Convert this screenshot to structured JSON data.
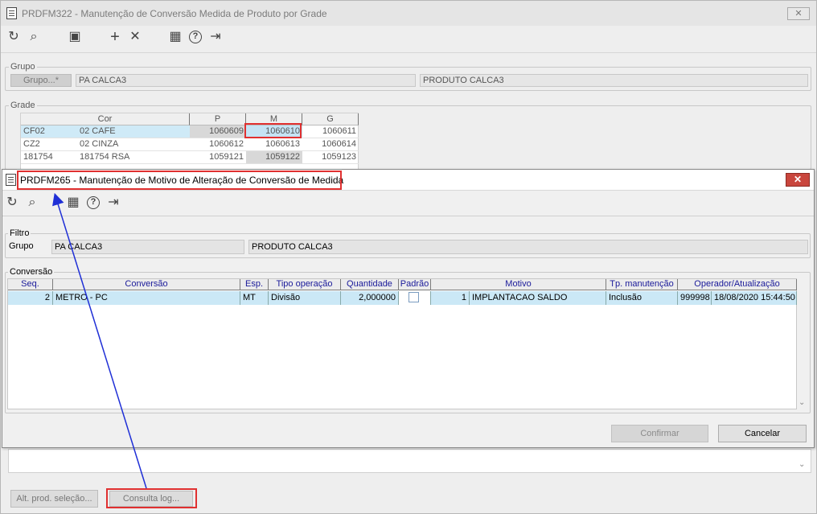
{
  "background_window": {
    "title": "PRDFM322 - Manutenção de Conversão Medida de Produto por Grade",
    "close_label": "✕",
    "toolbar": {
      "refresh": "↻",
      "search": "⌕",
      "save": "▣",
      "add": "+",
      "cancel": "✕",
      "calendar": "▦",
      "help": "?",
      "exit": "⇥"
    },
    "grupo": {
      "section_label": "Grupo",
      "button_label": "Grupo...*",
      "code": "PA CALCA3",
      "description": "PRODUTO CALCA3"
    },
    "grade": {
      "section_label": "Grade",
      "columns": [
        "Cor",
        "P",
        "M",
        "G"
      ],
      "rows": [
        {
          "code": "CF02",
          "name": "02 CAFE",
          "p": "1060609",
          "m": "1060610",
          "g": "1060611"
        },
        {
          "code": "CZ2",
          "name": "02 CINZA",
          "p": "1060612",
          "m": "1060613",
          "g": "1060614"
        },
        {
          "code": "181754",
          "name": "181754 RSA",
          "p": "1059121",
          "m": "1059122",
          "g": "1059123"
        }
      ]
    },
    "buttons": {
      "alt_prod": "Alt. prod. seleção...",
      "consulta_log": "Consulta log..."
    }
  },
  "dialog": {
    "title": "PRDFM265 - Manutenção de Motivo de Alteração de Conversão de Medida",
    "close_label": "✕",
    "toolbar": {
      "refresh": "↻",
      "search": "⌕",
      "calendar": "▦",
      "help": "?",
      "exit": "⇥"
    },
    "filtro": {
      "section_label": "Filtro",
      "grupo_label": "Grupo",
      "grupo_code": "PA CALCA3",
      "grupo_description": "PRODUTO CALCA3"
    },
    "conversao": {
      "section_label": "Conversão",
      "columns": [
        "Seq.",
        "Conversão",
        "Esp.",
        "Tipo operação",
        "Quantidade",
        "Padrão",
        "Motivo",
        "Tp. manutenção",
        "Operador/Atualização"
      ],
      "rows": [
        {
          "seq": "2",
          "conversao": "METRO - PC",
          "esp": "MT",
          "tipo_operacao": "Divisão",
          "quantidade": "2,000000",
          "padrao": false,
          "motivo_code": "1",
          "motivo": "IMPLANTACAO SALDO",
          "tp_manutencao": "Inclusão",
          "operador": "999998",
          "atualizacao": "18/08/2020 15:44:50"
        }
      ]
    },
    "buttons": {
      "confirmar": "Confirmar",
      "cancelar": "Cancelar"
    }
  },
  "colors": {
    "highlight_red": "#e03030",
    "arrow_blue": "#1f2fd6",
    "row_selected": "#cbe8f6"
  }
}
